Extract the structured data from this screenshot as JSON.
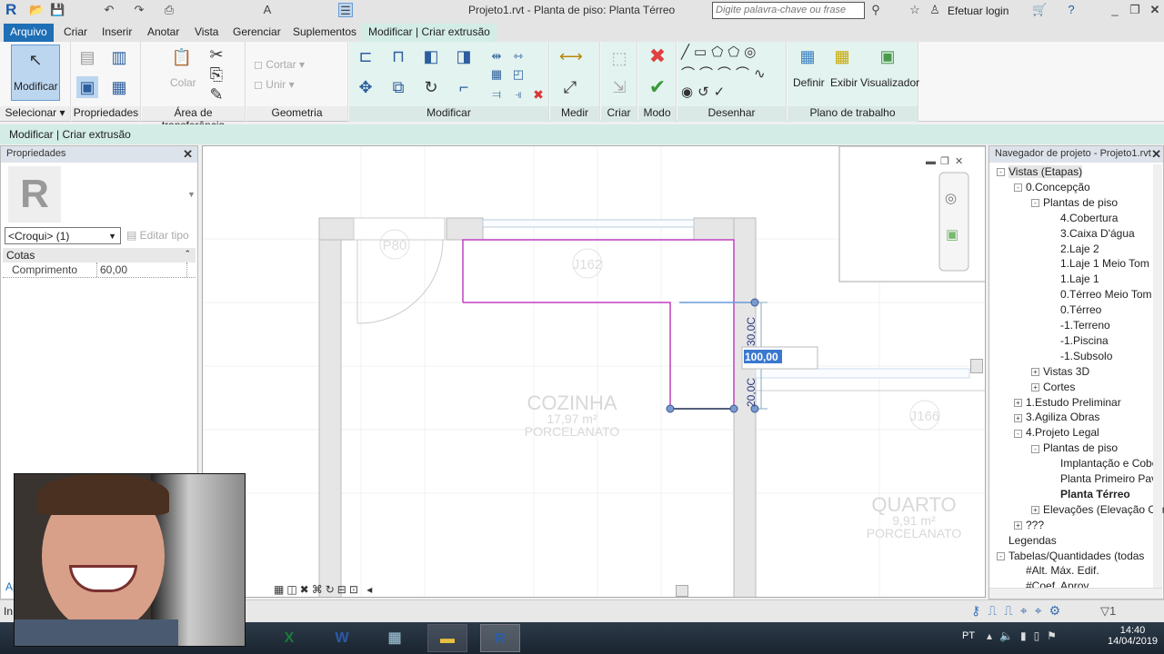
{
  "titlebar": {
    "title": "Projeto1.rvt - Planta de piso: Planta Térreo",
    "search_placeholder": "Digite palavra-chave ou frase",
    "login": "Efetuar login"
  },
  "tabs": [
    "Arquivo",
    "Criar",
    "Inserir",
    "Anotar",
    "Vista",
    "Gerenciar",
    "Suplementos",
    "Modificar | Criar extrusão"
  ],
  "ribbon": {
    "modificar": "Modificar",
    "colar": "Colar",
    "cortar": "Cortar",
    "unir": "Unir",
    "definir": "Definir",
    "exibir": "Exibir",
    "visualizador": "Visualizador",
    "panels": [
      "Selecionar",
      "Propriedades",
      "Área de transferência",
      "Geometria",
      "Modificar",
      "Medir",
      "Criar",
      "Modo",
      "Desenhar",
      "Plano de trabalho"
    ]
  },
  "optbar": "Modificar | Criar extrusão",
  "properties": {
    "title": "Propriedades",
    "type": "<Croqui> (1)",
    "edit_type": "Editar tipo",
    "group": "Cotas",
    "param": "Comprimento",
    "value": "60,00",
    "apply": "Ap"
  },
  "canvas": {
    "door_tag": "P80",
    "tag1": "J162",
    "tag2": "J166",
    "room1": {
      "name": "COZINHA",
      "area": "17,97 m²",
      "floor": "PORCELANATO"
    },
    "room2": {
      "name": "QUARTO",
      "area": "9,91 m²",
      "floor": "PORCELANATO"
    },
    "dim_input": "100,00",
    "dim1": "30,0C",
    "dim2": "20,0C"
  },
  "browser": {
    "title": "Navegador de projeto - Projeto1.rvt",
    "items": [
      {
        "label": "Vistas (Etapas)",
        "level": 0,
        "pm": "-"
      },
      {
        "label": "0.Concepção",
        "level": 1,
        "pm": "-"
      },
      {
        "label": "Plantas de piso",
        "level": 2,
        "pm": "-"
      },
      {
        "label": "4.Cobertura",
        "level": 3
      },
      {
        "label": "3.Caixa D'água",
        "level": 3
      },
      {
        "label": "2.Laje 2",
        "level": 3
      },
      {
        "label": "1.Laje 1 Meio Tom",
        "level": 3
      },
      {
        "label": "1.Laje 1",
        "level": 3
      },
      {
        "label": "0.Térreo Meio Tom",
        "level": 3
      },
      {
        "label": "0.Térreo",
        "level": 3
      },
      {
        "label": "-1.Terreno",
        "level": 3
      },
      {
        "label": "-1.Piscina",
        "level": 3
      },
      {
        "label": "-1.Subsolo",
        "level": 3
      },
      {
        "label": "Vistas 3D",
        "level": 2,
        "pm": "+"
      },
      {
        "label": "Cortes",
        "level": 2,
        "pm": "+"
      },
      {
        "label": "1.Estudo Preliminar",
        "level": 1,
        "pm": "+"
      },
      {
        "label": "3.Agiliza Obras",
        "level": 1,
        "pm": "+"
      },
      {
        "label": "4.Projeto Legal",
        "level": 1,
        "pm": "-"
      },
      {
        "label": "Plantas de piso",
        "level": 2,
        "pm": "-"
      },
      {
        "label": "Implantação e Cobe",
        "level": 3
      },
      {
        "label": "Planta Primeiro Pavi",
        "level": 3
      },
      {
        "label": "Planta Térreo",
        "level": 3,
        "bold": true
      },
      {
        "label": "Elevações (Elevação Cor",
        "level": 2,
        "pm": "+"
      },
      {
        "label": "???",
        "level": 1,
        "pm": "+"
      },
      {
        "label": "Legendas",
        "level": 0
      },
      {
        "label": "Tabelas/Quantidades (todas",
        "level": 0,
        "pm": "-"
      },
      {
        "label": "#Alt. Máx. Edif.",
        "level": 1
      },
      {
        "label": "#Coef. Aprov.",
        "level": 1
      }
    ]
  },
  "status": {
    "filter": "1",
    "left": "In"
  },
  "taskbar": {
    "lang": "PT",
    "time": "14:40",
    "date": "14/04/2019",
    "apps": [
      "X",
      "W",
      "calc",
      "files",
      "R"
    ]
  },
  "colors": {
    "accent": "#1e6fb5",
    "sketch": "#c040c0",
    "ctx": "#d3ece6"
  }
}
